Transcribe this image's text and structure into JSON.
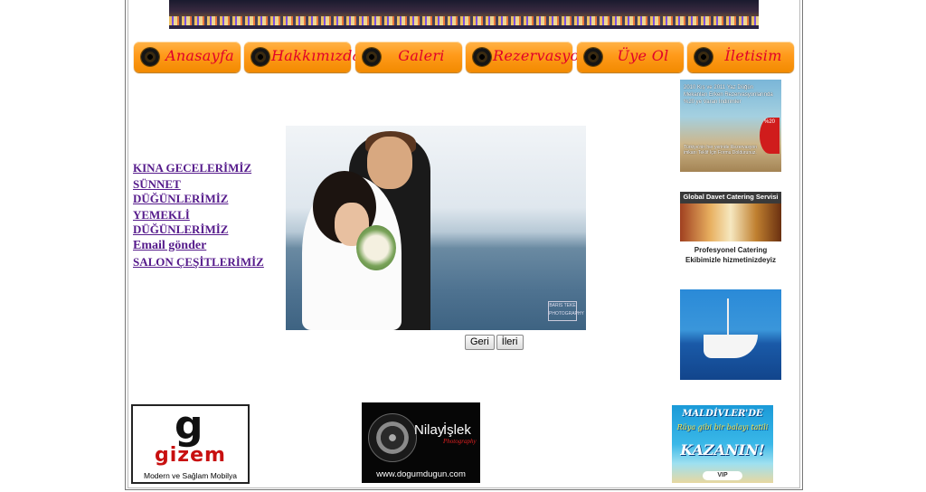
{
  "nav": {
    "items": [
      {
        "label": "Anasayfa"
      },
      {
        "label": "Hakkımızda"
      },
      {
        "label": "Galeri"
      },
      {
        "label": "Rezervasyon"
      },
      {
        "label": "Üye Ol"
      },
      {
        "label": "İletisim"
      }
    ]
  },
  "sidebar": {
    "links": [
      {
        "label": "KINA GECELERİMİZ"
      },
      {
        "label": "SÜNNET DÜĞÜNLERİMİZ"
      },
      {
        "label": "YEMEKLİ DÜĞÜNLERİMİZ"
      },
      {
        "label": "Email gönder"
      },
      {
        "label": "SALON ÇEŞİTLERİMİZ"
      }
    ]
  },
  "slideshow": {
    "watermark": "BARIS TEKE PHOTOGRAPHY",
    "prev_label": "Geri",
    "next_label": "İleri"
  },
  "ads": {
    "promo": {
      "headline": "2010 Kış ve 2011 Yaz Düğün Mekanları Erken Rezervasyonlarında %20 ye Varan İndirimler",
      "body": "Türkiye'nin her yerinde Rezervasyon imkanı Teklif İçin Formu Doldurunuz.",
      "badge": "%20"
    },
    "catering": {
      "header": "Global Davet Catering Servisi",
      "text": "Profesyonel Catering Ekibimizle hizmetinizdeyiz"
    },
    "gizem": {
      "logo_letter": "g",
      "name": "gizem",
      "tagline": "Modern ve Sağlam Mobilya"
    },
    "nilay": {
      "name_first": "Nilay",
      "name_last": "İşlek",
      "sub": "Photography",
      "url": "www.dogumdugun.com"
    },
    "maldives": {
      "headline": "MALDİVLER'DE",
      "message": "Rüya gibi bir balayı tatili",
      "cta": "KAZANIN!",
      "badge": "VIP"
    }
  },
  "colors": {
    "nav_text": "#e0002a",
    "nav_bg": "#ff9a1a",
    "link": "#551a8b"
  }
}
